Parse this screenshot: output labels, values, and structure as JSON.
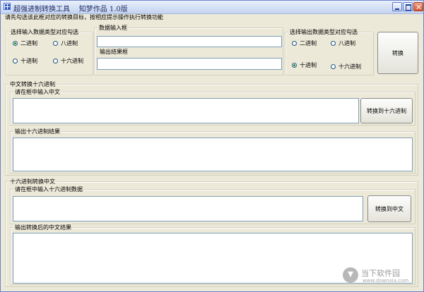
{
  "window": {
    "title": "超强进制转换工具    知梦作品 1.0版",
    "hint": "请先勾选该此框对应的转换目标，按相应提示操作执行转换功能"
  },
  "input_types": {
    "legend": "选择输入数据类型对应勾选",
    "options": [
      {
        "label": "二进制",
        "selected": true
      },
      {
        "label": "八进制",
        "selected": false
      },
      {
        "label": "十进制",
        "selected": false
      },
      {
        "label": "十六进制",
        "selected": false
      }
    ]
  },
  "data_input": {
    "legend": "数据输入框",
    "value": ""
  },
  "data_output": {
    "legend": "输出结果框",
    "value": ""
  },
  "output_types": {
    "legend": "选择输出数据类型对应勾选",
    "options": [
      {
        "label": "二进制",
        "selected": false
      },
      {
        "label": "八进制",
        "selected": false
      },
      {
        "label": "十进制",
        "selected": true
      },
      {
        "label": "十六进制",
        "selected": false
      }
    ]
  },
  "convert_button": "转换",
  "cn_to_hex": {
    "legend": "中文转换十六进制",
    "input_legend": "请在框中输入中文",
    "input_value": "",
    "button": "转换到十六进制",
    "output_legend": "输出十六进制结果",
    "output_value": ""
  },
  "hex_to_cn": {
    "legend": "十六进制转换中文",
    "input_legend": "请在框中输入十六进制数据",
    "input_value": "",
    "button": "转换到中文",
    "output_legend": "输出转换后的中文结果",
    "output_value": ""
  },
  "watermark": {
    "name": "当下软件园",
    "url": "www.downxia.com"
  }
}
